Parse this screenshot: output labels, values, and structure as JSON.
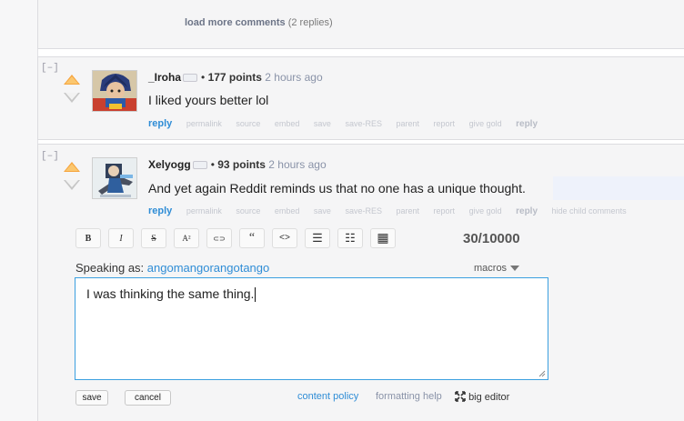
{
  "load_more": {
    "label": "load more comments",
    "count": "(2 replies)"
  },
  "comments": [
    {
      "collapse": "[–]",
      "user": "_Iroha",
      "points": "177 points",
      "time": "2 hours ago",
      "text": "I liked yours better lol",
      "actions": [
        "permalink",
        "source",
        "embed",
        "save",
        "save-RES",
        "parent",
        "report",
        "give gold"
      ],
      "reply_label": "reply",
      "reply_label_2": "reply"
    },
    {
      "collapse": "[–]",
      "user": "Xelyogg",
      "points": "93 points",
      "time": "2 hours ago",
      "text": "And yet again Reddit reminds us that no one has a unique thought.",
      "actions": [
        "permalink",
        "source",
        "embed",
        "save",
        "save-RES",
        "parent",
        "report",
        "give gold"
      ],
      "reply_label": "reply",
      "reply_label_2": "reply",
      "hide_child": "hide child comments"
    }
  ],
  "editor": {
    "toolbar": [
      {
        "icon": "bold-icon",
        "glyph": "B"
      },
      {
        "icon": "italic-icon",
        "glyph": "I"
      },
      {
        "icon": "strikethrough-icon",
        "glyph": "S"
      },
      {
        "icon": "superscript-icon",
        "glyph": "A²"
      },
      {
        "icon": "link-icon",
        "glyph": "⊂⊃"
      },
      {
        "icon": "quote-icon",
        "glyph": "“"
      },
      {
        "icon": "code-icon",
        "glyph": "<>"
      },
      {
        "icon": "bullet-list-icon",
        "glyph": "☰"
      },
      {
        "icon": "numbered-list-icon",
        "glyph": "☷"
      },
      {
        "icon": "table-icon",
        "glyph": "▦"
      }
    ],
    "counter": "30/10000",
    "speaking_as_label": "Speaking as:",
    "speaking_as_user": "angomangorangotango",
    "macros_label": "macros",
    "value": "I was thinking the same thing.",
    "save_label": "save",
    "cancel_label": "cancel",
    "content_policy": "content policy",
    "formatting_help": "formatting help",
    "big_editor": "big editor"
  },
  "colors": {
    "accent": "#2f8dd6",
    "upvote": "#f6a53e",
    "focus_border": "#3ba0e0"
  }
}
